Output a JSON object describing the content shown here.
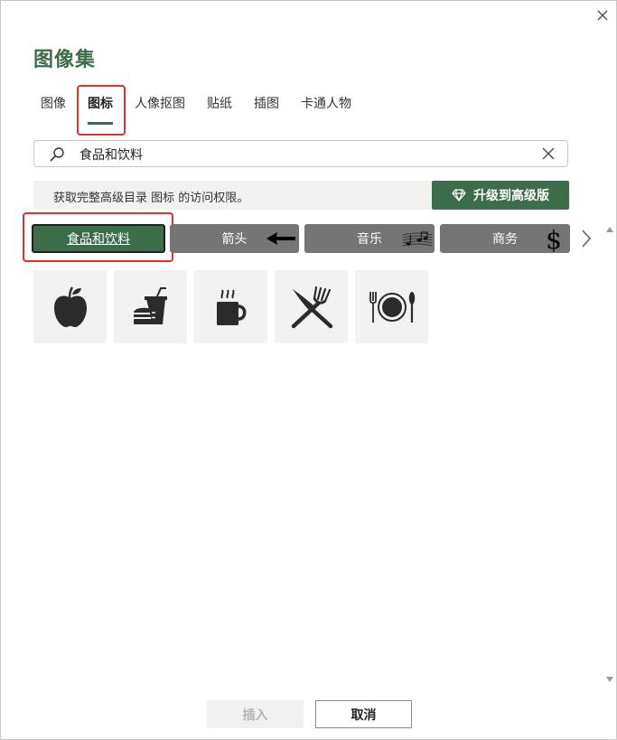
{
  "dialog": {
    "title": "图像集"
  },
  "tabs": [
    {
      "label": "图像",
      "active": false
    },
    {
      "label": "图标",
      "active": true
    },
    {
      "label": "人像抠图",
      "active": false
    },
    {
      "label": "贴纸",
      "active": false
    },
    {
      "label": "插图",
      "active": false
    },
    {
      "label": "卡通人物",
      "active": false
    }
  ],
  "search": {
    "value": "食品和饮料"
  },
  "banner": {
    "text": "获取完整高级目录 图标 的访问权限。",
    "upgrade_label": "升级到高级版"
  },
  "categories": [
    {
      "label": "食品和饮料",
      "active": true,
      "icon": ""
    },
    {
      "label": "箭头",
      "active": false,
      "icon": "arrow-left-icon"
    },
    {
      "label": "音乐",
      "active": false,
      "icon": "music-notes-icon"
    },
    {
      "label": "商务",
      "active": false,
      "icon": "dollar-sign-icon"
    }
  ],
  "icons": [
    {
      "name": "apple-icon"
    },
    {
      "name": "fast-food-icon"
    },
    {
      "name": "coffee-cup-icon"
    },
    {
      "name": "fork-knife-crossed-icon"
    },
    {
      "name": "plate-dining-icon"
    }
  ],
  "buttons": {
    "insert": "插入",
    "cancel": "取消",
    "insert_enabled": false
  },
  "colors": {
    "accent": "#3b6d4a",
    "category_bg": "#757575",
    "highlight": "#e03030",
    "tile_bg": "#f2f2f2"
  }
}
